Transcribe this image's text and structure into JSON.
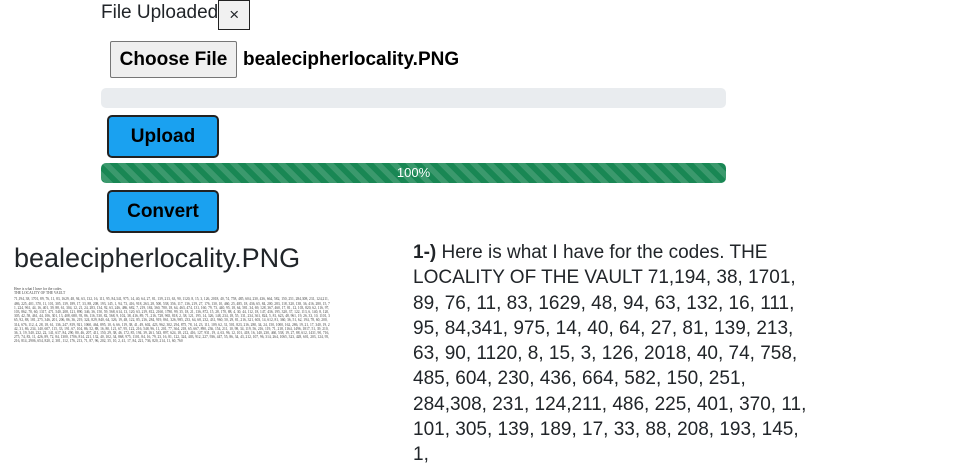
{
  "upload_status": {
    "text": "File Uploaded",
    "dismiss_label": "×"
  },
  "file_input": {
    "button_label": "Choose File",
    "file_name": "bealecipherlocality.PNG"
  },
  "upload_progress": {
    "value": 0
  },
  "upload_button": {
    "label": "Upload"
  },
  "convert_progress": {
    "value": 100,
    "label": "100%"
  },
  "convert_button": {
    "label": "Convert"
  },
  "preview": {
    "title": "bealecipherlocality.PNG",
    "thumb_line1": "Here is what I have for the codes.",
    "thumb_line2": "THE LOCALITY OF THE VAULT",
    "thumb_body": "71,194, 38, 1701, 89, 76, 11, 83, 1629, 48, 94, 63, 132, 16, 111, 95, 84,341, 975, 14, 40, 64, 27, 81, 139, 213, 63, 90, 1120, 8, 15, 3, 126, 2018, 40, 74, 758, 485, 604, 230, 436, 664, 582, 150, 251, 284,308, 231, 124,211, 486, 225, 401, 370, 11, 101, 305, 139, 189, 17, 33, 88, 208, 193, 145, 1, 94, 73, 416, 918, 263, 28, 500, 538, 356, 117, 136, 219, 27, 176, 130, 10, 460, 25, 485, 18, 436, 65, 84, 200, 283, 118, 320, 138, 36, 416, 280, 15, 71, 224, 961, 44, 16, 401, 39, 88, 61, 304, 12, 21, 24, 283, 134, 92, 63, 246, 486, 682, 7, 219, 184, 360, 780, 18, 64, 463, 474, 131, 160, 79, 73, 440, 95, 18, 64, 581, 34, 69, 128, 367, 460, 17, 81, 12, 103, 820, 62, 116, 97, 103, 862, 70, 60, 1317, 471, 540, 208, 121, 890, 346, 36, 150, 59, 568, 614, 13, 120, 63, 219, 812, 2160, 1780, 99, 35, 18, 21, 136, 872, 15, 28, 170, 88, 4, 30, 44, 112, 18, 147, 436, 195, 320, 37, 122, 113, 6, 140, 8, 120, 305, 42, 58, 461, 44, 106, 301, 13, 408, 680, 93, 86, 116, 530, 82, 568, 9, 102, 38, 416, 89, 71, 216, 728, 965, 818, 2, 38, 121, 195, 14, 326, 148, 234, 18, 55, 131, 234, 361, 824, 5, 81, 623, 48, 961, 19, 26, 33, 10, 1101, 365, 92, 88, 181, 275, 346, 201, 206, 86, 36, 219, 324, 829, 840, 64, 326, 19, 48, 122, 85, 216, 284, 919, 861, 326, 985, 233, 64, 68, 232, 431, 960, 50, 29, 81, 216, 321, 603, 14, 612, 81, 360, 36, 51, 62, 194, 78, 60, 200, 314, 676, 112, 4, 28, 18, 61, 136, 247, 819, 921, 1060, 464, 895, 10, 6, 66, 119, 38, 41, 49, 602, 423, 962, 302, 294, 875, 78, 14, 23, 111, 109, 62, 31, 501, 823, 216, 280, 34, 24, 150, 1000, 162, 286, 19, 21, 17, 340, 19, 242, 31, 86, 234, 140, 607, 115, 33, 191, 67, 104, 86, 52, 88, 16, 80, 121, 67, 95, 122, 216, 548, 96, 11, 201, 77, 364, 218, 65, 667, 890, 236, 154, 211, 10, 98, 34, 119, 56, 216, 119, 71, 218, 1164, 1496, 1817, 51, 39, 210, 36, 3, 19, 540, 232, 22, 141, 617, 84, 290, 80, 46, 207, 411, 150, 29, 38, 46, 172, 85, 194, 39, 261, 543, 897, 624, 18, 212, 416, 127, 931, 19, 4, 63, 96, 12, 101, 418, 16, 140, 230, 460, 538, 19, 27, 88, 612, 1431, 90, 716, 275, 74, 83, 11, 426, 89, 72, 84, 1300, 1706, 814, 221, 132, 40, 102, 34, 868, 975, 1101, 84, 16, 79, 23, 16, 81, 122, 324, 403, 912, 227, 936, 447, 55, 86, 34, 43, 212, 107, 96, 314, 264, 1065, 323, 428, 601, 203, 124, 95, 216, 814, 2906, 654, 820, 2, 301, 112, 176, 213, 71, 87, 96, 202, 35, 10, 2, 41, 17, 84, 221, 736, 820, 214, 11, 60, 760"
  },
  "result": {
    "prefix": "1-)",
    "text": " Here is what I have for the codes. THE LOCALITY OF THE VAULT 71,194, 38, 1701, 89, 76, 11, 83, 1629, 48, 94, 63, 132, 16, 111, 95, 84,341, 975, 14, 40, 64, 27, 81, 139, 213, 63, 90, 1120, 8, 15, 3, 126, 2018, 40, 74, 758, 485, 604, 230, 436, 664, 582, 150, 251, 284,308, 231, 124,211, 486, 225, 401, 370, 11, 101, 305, 139, 189, 17, 33, 88, 208, 193, 145, 1,"
  }
}
